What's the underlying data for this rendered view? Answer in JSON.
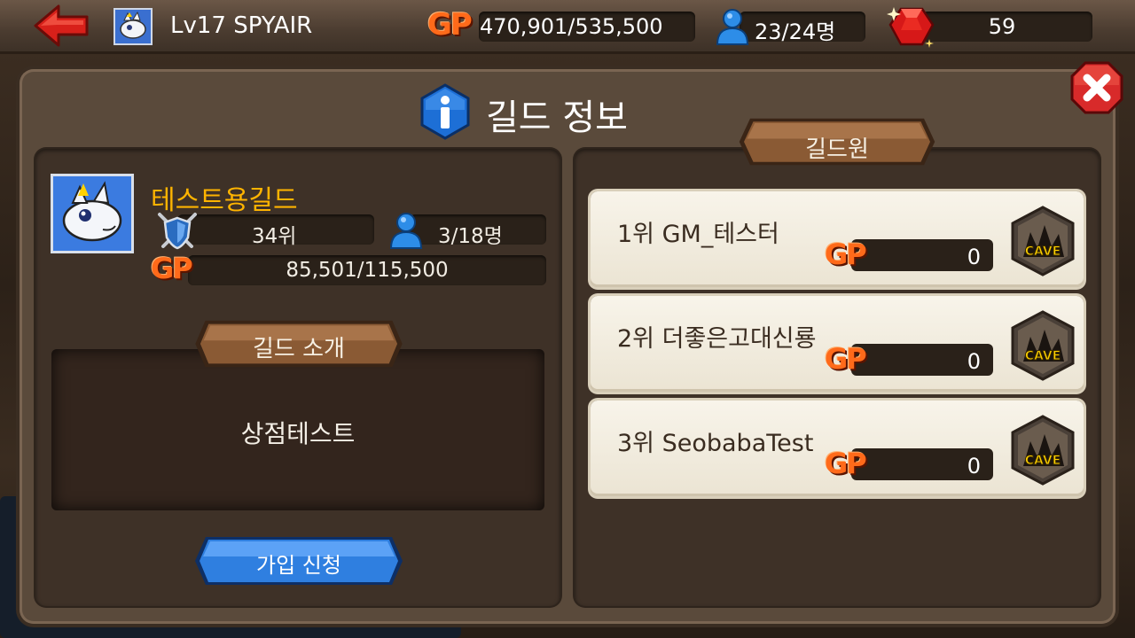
{
  "topbar": {
    "level_text": "Lv17 SPYAIR",
    "gp_label": "GP",
    "gp_value": "470,901/535,500",
    "members_value": "23/24명",
    "gems_value": "59"
  },
  "dialog": {
    "title": "길드 정보"
  },
  "guild": {
    "name": "테스트용길드",
    "rank": "34위",
    "members": "3/18명",
    "gp_label": "GP",
    "gp_value": "85,501/115,500",
    "intro_header": "길드 소개",
    "intro_text": "상점테스트",
    "join_button": "가입 신청"
  },
  "members_panel": {
    "header": "길드원",
    "members": [
      {
        "name": "1위 GM_테스터",
        "gp_label": "GP",
        "gp": "0",
        "badge": "CAVE"
      },
      {
        "name": "2위 더좋은고대신룡",
        "gp_label": "GP",
        "gp": "0",
        "badge": "CAVE"
      },
      {
        "name": "3위 SeobabaTest",
        "gp_label": "GP",
        "gp": "0",
        "badge": "CAVE"
      }
    ]
  },
  "colors": {
    "accent_gold": "#ffb400",
    "gp_orange": "#ff6a1a",
    "button_blue": "#2f7fe0",
    "close_red": "#d82a2a"
  }
}
